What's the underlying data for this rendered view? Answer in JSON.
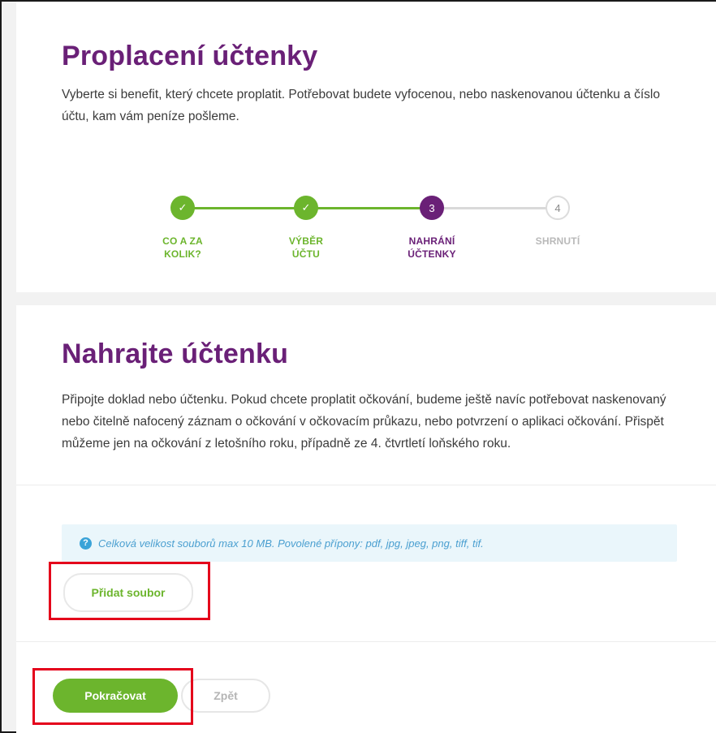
{
  "section1": {
    "title": "Proplacení účtenky",
    "lead_line1": "Vyberte si benefit, který chcete proplatit. Potřebovat budete vyfocenou, nebo naskenovanou účtenku a číslo",
    "lead_line2": "účtu, kam vám peníze pošleme."
  },
  "stepper": {
    "steps": [
      {
        "label_line1": "CO A ZA",
        "label_line2": "KOLIK?",
        "state": "done",
        "marker": "✓"
      },
      {
        "label_line1": "VÝBĚR",
        "label_line2": "ÚČTU",
        "state": "done",
        "marker": "✓"
      },
      {
        "label_line1": "NAHRÁNÍ",
        "label_line2": "ÚČTENKY",
        "state": "active",
        "marker": "3"
      },
      {
        "label_line1": "SHRNUTÍ",
        "label_line2": "",
        "state": "todo",
        "marker": "4"
      }
    ]
  },
  "section2": {
    "title": "Nahrajte účtenku",
    "lead_line1": "Připojte doklad nebo účtenku. Pokud chcete proplatit očkování, budeme ještě navíc potřebovat naskenovaný",
    "lead_line2": "nebo čitelně nafocený záznam o očkování v očkovacím průkazu, nebo potvrzení o aplikaci očkování. Přispět",
    "lead_line3": "můžeme jen na očkování z letošního roku, případně ze 4. čtvrtletí loňského roku.",
    "info_icon": "?",
    "info_text": "Celková velikost souborů max 10 MB. Povolené přípony: pdf, jpg, jpeg, png, tiff, tif.",
    "add_file_label": "Přidat soubor"
  },
  "actions": {
    "next_label": "Pokračovat",
    "back_label": "Zpět"
  },
  "colors": {
    "brand_purple": "#6a2077",
    "brand_green": "#6cb52d",
    "highlight_red": "#e4001b"
  }
}
